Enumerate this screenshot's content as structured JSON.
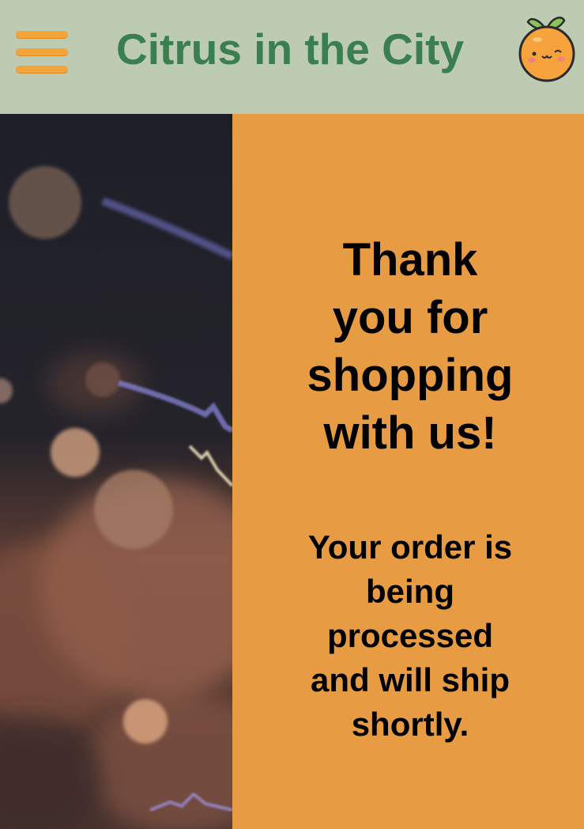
{
  "header": {
    "brand_title": "Citrus in the City",
    "menu_icon": "hamburger-menu-icon",
    "logo_icon": "smiling-orange-icon"
  },
  "hero": {
    "image": "bokeh-lights-photo"
  },
  "confirmation": {
    "headline": "Thank you for shopping with us!",
    "message": "Your order is being processed and will ship shortly."
  },
  "colors": {
    "header_bg": "#bdcbb3",
    "brand_text": "#3b7e4f",
    "menu_accent": "#f3a53c",
    "panel_bg": "#e79c44"
  }
}
